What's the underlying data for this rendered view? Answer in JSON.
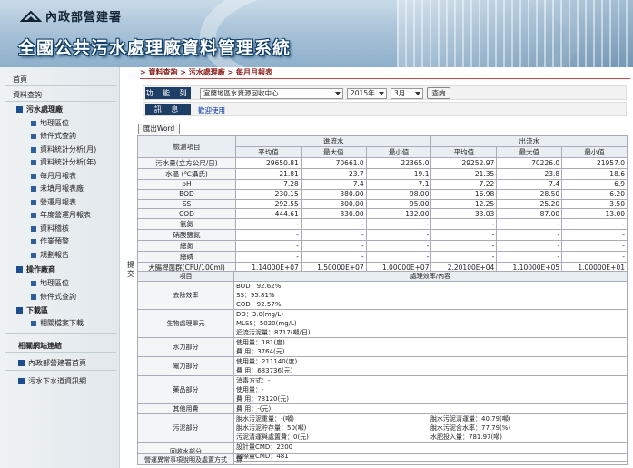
{
  "header": {
    "org_name": "內政部營建署",
    "system_title": "全國公共污水處理廠資料管理系統"
  },
  "sidebar": {
    "home": "首頁",
    "section_query": "資料查詢",
    "group1": "污水處理廠",
    "group1_items": [
      "地理區位",
      "條件式查詢",
      "資料統計分析(月)",
      "資料統計分析(年)",
      "每月月報表",
      "未填月報表廠",
      "營運月報表",
      "年度營運月報表",
      "資料稽核",
      "作業預警",
      "規劃報告"
    ],
    "group2": "操作廠商",
    "group2_items": [
      "地理區位",
      "條件式查詢"
    ],
    "group3": "下載區",
    "group3_items": [
      "相關檔案下載"
    ],
    "section_links": "相關網站連結",
    "links": [
      "內政部營建署首頁",
      "污水下水道資訊網"
    ]
  },
  "breadcrumb": "> 資料查詢 > 污水處理廠 > 每月月報表",
  "query": {
    "function_label": "功 能 列",
    "plant_selected": "宜蘭地區水資源回收中心",
    "year_selected": "2015年",
    "month_selected": "3月",
    "search_button": "查詢",
    "message_label": "訊 息",
    "message_text": "歡迎使用"
  },
  "export_button": "匯出Word",
  "side_chars": [
    "提",
    "交"
  ],
  "report": {
    "item_header": "檢測項目",
    "influent": "進流水",
    "effluent": "出流水",
    "stat_headers": [
      "平均值",
      "最大值",
      "最小值",
      "平均值",
      "最大值",
      "最小值"
    ],
    "rows": [
      {
        "name": "污水量(立方公尺/日)",
        "values": [
          "29650.81",
          "70661.0",
          "22365.0",
          "29252.97",
          "70226.0",
          "21957.0"
        ]
      },
      {
        "name": "水溫 (℃攝氏)",
        "values": [
          "21.81",
          "23.7",
          "19.1",
          "21.35",
          "23.8",
          "18.6"
        ]
      },
      {
        "name": "pH",
        "values": [
          "7.28",
          "7.4",
          "7.1",
          "7.22",
          "7.4",
          "6.9"
        ]
      },
      {
        "name": "BOD",
        "values": [
          "230.15",
          "380.00",
          "98.00",
          "16.98",
          "28.50",
          "6.20"
        ]
      },
      {
        "name": "SS",
        "values": [
          "292.55",
          "800.00",
          "95.00",
          "12.25",
          "25.20",
          "3.50"
        ]
      },
      {
        "name": "COD",
        "values": [
          "444.61",
          "830.00",
          "132.00",
          "33.03",
          "87.00",
          "13.00"
        ]
      },
      {
        "name": "氨氮",
        "values": [
          "-",
          "-",
          "-",
          "-",
          "-",
          "-"
        ]
      },
      {
        "name": "硝酸鹽氮",
        "values": [
          "-",
          "-",
          "-",
          "-",
          "-",
          "-"
        ]
      },
      {
        "name": "總氮",
        "values": [
          "-",
          "-",
          "-",
          "-",
          "-",
          "-"
        ]
      },
      {
        "name": "總磷",
        "values": [
          "-",
          "-",
          "-",
          "-",
          "-",
          "-"
        ]
      },
      {
        "name": "大腸桿菌群(CFU/100ml)",
        "values": [
          "1.14000E+07",
          "1.50000E+07",
          "1.00000E+07",
          "2.20100E+04",
          "1.10000E+05",
          "1.00000E+01"
        ]
      }
    ]
  },
  "process": {
    "col_item": "項目",
    "col_content": "處理效率/內容",
    "rows": [
      {
        "name": "去除效率",
        "lines": [
          "BOD：92.62%",
          "SS：95.81%",
          "COD：92.57%"
        ]
      },
      {
        "name": "生物處理單元",
        "lines": [
          "DO：3.0(mg/L)",
          "MLSS：5020(mg/L)",
          "迴流污泥量：8717(噸/日)"
        ]
      },
      {
        "name": "水力部分",
        "lines": [
          "使用量：181(度)",
          "費 用：3764(元)"
        ]
      },
      {
        "name": "電力部分",
        "lines": [
          "使用量：211140(度)",
          "費 用：683736(元)"
        ]
      },
      {
        "name": "藥品部分",
        "lines": [
          "消毒方式：-",
          "使用量：-",
          "費 用：78120(元)"
        ]
      },
      {
        "name": "其他用費",
        "lines": [
          "費 用：-(元)"
        ]
      },
      {
        "name": "污泥部分",
        "left": [
          "脫水污泥重量：-(噸)",
          "脫水污泥貯存量：50(噸)",
          "污泥清運與處置費：0(元)"
        ],
        "right": [
          "脫水污泥清運量：40.79(噸)",
          "脫水污泥含水率：77.79(%)",
          "水肥投入量：781.97(噸)"
        ]
      },
      {
        "name": "回收水部分",
        "lines": [
          "設計量CMD：2200",
          "廠際量CMD：481"
        ]
      }
    ]
  },
  "footer_row": {
    "name": "營運異常事項說明及處置方式",
    "value": "無"
  }
}
